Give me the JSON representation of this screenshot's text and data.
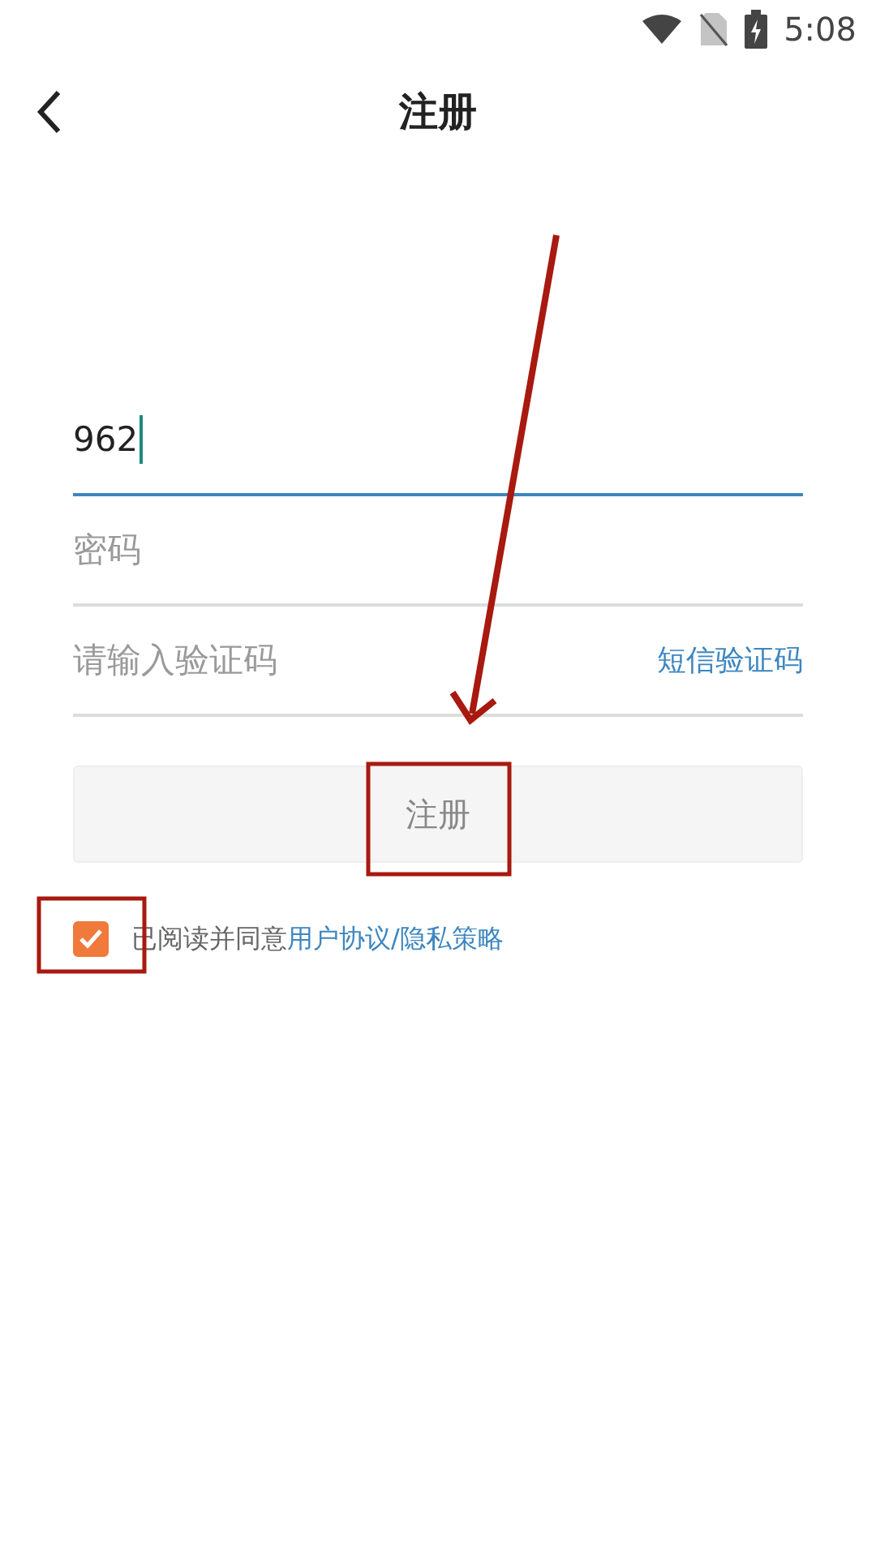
{
  "status_bar": {
    "time": "5:08"
  },
  "header": {
    "title": "注册"
  },
  "fields": [
    {
      "value": "962",
      "focused": true
    },
    {
      "placeholder": "密码",
      "focused": false
    },
    {
      "placeholder": "请输入验证码",
      "focused": false,
      "action": "短信验证码"
    }
  ],
  "submit_button": {
    "label": "注册"
  },
  "agreement": {
    "checked": true,
    "text": "已阅读并同意",
    "link_1": "用户协议",
    "separator": "/",
    "link_2": "隐私策略"
  }
}
